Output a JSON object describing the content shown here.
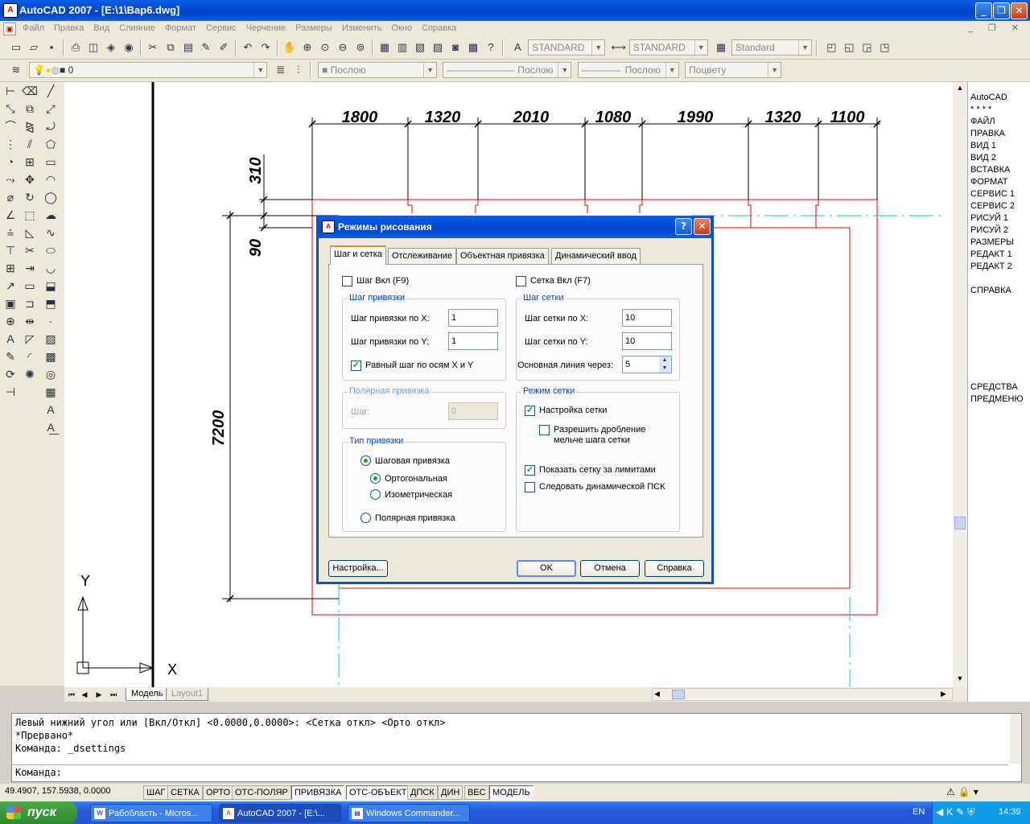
{
  "window": {
    "title": "AutoCAD 2007 - [E:\\1\\Вар6.dwg]",
    "app_icon": "A",
    "min": "_",
    "restore": "❐",
    "close": "✕"
  },
  "menu": [
    "Файл",
    "Правка",
    "Вид",
    "Слияние",
    "Формат",
    "Сервис",
    "Черчение",
    "Размеры",
    "Изменить",
    "Окно",
    "Справка"
  ],
  "mdi_controls": "_ ❐ ✕",
  "toolbar1": {
    "text_style": "STANDARD",
    "dim_style": "STANDARD",
    "table_style": "Standard"
  },
  "toolbar2": {
    "layer": "0",
    "color": "Послою",
    "linetype": "Послою",
    "lineweight": "Послою",
    "plot_style": "Поцвету"
  },
  "drawing": {
    "top_dims": [
      "1800",
      "1320",
      "2010",
      "1080",
      "1990",
      "1320",
      "1100"
    ],
    "left_dims": [
      "310",
      "90",
      "7200"
    ],
    "ucs_x": "X",
    "ucs_y": "Y"
  },
  "right_menu": [
    "AutoCAD",
    "* * * *",
    "ФАЙЛ",
    "ПРАВКА",
    "ВИД 1",
    "ВИД 2",
    "ВСТАВКА",
    "ФОРМАТ",
    "СЕРВИС 1",
    "СЕРВИС 2",
    "РИСУЙ 1",
    "РИСУЙ 2",
    "РАЗМЕРЫ",
    "РЕДАКТ 1",
    "РЕДАКТ 2",
    "СПРАВКА",
    "СРЕДСТВА",
    "ПРЕДМЕНЮ"
  ],
  "tabs": {
    "model": "Модель",
    "layout": "Layout1"
  },
  "command": {
    "history": [
      "Левый нижний угол или [Вкл/Откл] <0.0000,0.0000>:  <Сетка откл>  <Орто откл>",
      "*Прервано*",
      "Команда: _dsettings"
    ],
    "prompt": "Команда:"
  },
  "status": {
    "coords": "49.4907, 157.5938, 0.0000",
    "buttons": [
      {
        "label": "ШАГ",
        "pressed": false
      },
      {
        "label": "СЕТКА",
        "pressed": false
      },
      {
        "label": "ОРТО",
        "pressed": false
      },
      {
        "label": "ОТС-ПОЛЯР",
        "pressed": false
      },
      {
        "label": "ПРИВЯЗКА",
        "pressed": true
      },
      {
        "label": "ОТС-ОБЪЕКТ",
        "pressed": true
      },
      {
        "label": "ДПСК",
        "pressed": false
      },
      {
        "label": "ДИН",
        "pressed": false
      },
      {
        "label": "ВЕС",
        "pressed": false
      },
      {
        "label": "МОДЕЛЬ",
        "pressed": true
      }
    ]
  },
  "taskbar": {
    "start": "пуск",
    "tasks": [
      "Рабобласть - Micros...",
      "AutoCAD 2007 - [E:\\...",
      "Windows Commander..."
    ],
    "lang": "EN",
    "clock": "14:39"
  },
  "dialog": {
    "title": "Режимы рисования",
    "help": "?",
    "close": "✕",
    "tabs": [
      "Шаг и сетка",
      "Отслеживание",
      "Объектная привязка",
      "Динамический ввод"
    ],
    "snap_on": "Шаг Вкл (F9)",
    "grid_on": "Сетка Вкл (F7)",
    "snap_group": {
      "caption": "Шаг привязки",
      "x_label": "Шаг привязки по X:",
      "x_value": "1",
      "y_label": "Шаг привязки по Y:",
      "y_value": "1",
      "equal": "Равный шаг по осям X и Y"
    },
    "grid_group": {
      "caption": "Шаг сетки",
      "x_label": "Шаг сетки по X:",
      "x_value": "10",
      "y_label": "Шаг сетки по Y:",
      "y_value": "10",
      "major_label": "Основная линия через:",
      "major_value": "5"
    },
    "polar_group": {
      "caption": "Полярная привязка",
      "label": "Шаг:",
      "value": "0"
    },
    "type_group": {
      "caption": "Тип привязки",
      "grid_snap": "Шаговая привязка",
      "rect": "Ортогональная",
      "iso": "Изометрическая",
      "polar": "Полярная привязка"
    },
    "grid_mode": {
      "caption": "Режим сетки",
      "adaptive": "Настройка сетки",
      "subdiv_1": "Разрешить дробление",
      "subdiv_2": "мельче шага сетки",
      "beyond": "Показать сетку за лимитами",
      "follow": "Следовать динамической ПСК"
    },
    "buttons": {
      "options": "Настройка...",
      "ok": "OK",
      "cancel": "Отмена",
      "help": "Справка"
    }
  }
}
